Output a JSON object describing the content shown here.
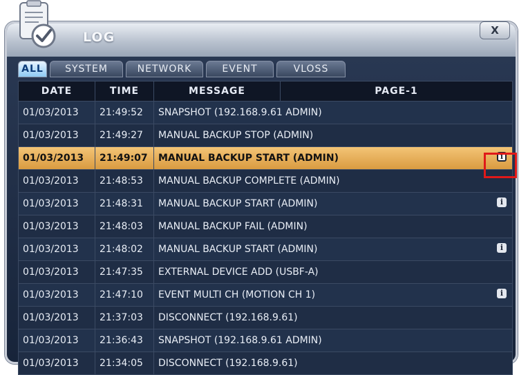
{
  "window": {
    "title": "LOG",
    "close_label": "X"
  },
  "tabs": [
    {
      "label": "ALL",
      "active": true
    },
    {
      "label": "SYSTEM",
      "active": false
    },
    {
      "label": "NETWORK",
      "active": false
    },
    {
      "label": "EVENT",
      "active": false
    },
    {
      "label": "VLOSS",
      "active": false
    }
  ],
  "table": {
    "headers": {
      "date": "DATE",
      "time": "TIME",
      "message": "MESSAGE",
      "page": "PAGE-1"
    },
    "rows": [
      {
        "date": "01/03/2013",
        "time": "21:49:52",
        "message": "SNAPSHOT (192.168.9.61 ADMIN)",
        "info": false
      },
      {
        "date": "01/03/2013",
        "time": "21:49:27",
        "message": "MANUAL BACKUP STOP (ADMIN)",
        "info": false
      },
      {
        "date": "01/03/2013",
        "time": "21:49:07",
        "message": "MANUAL BACKUP START (ADMIN)",
        "info": true,
        "selected": true
      },
      {
        "date": "01/03/2013",
        "time": "21:48:53",
        "message": "MANUAL BACKUP COMPLETE (ADMIN)",
        "info": false
      },
      {
        "date": "01/03/2013",
        "time": "21:48:31",
        "message": "MANUAL BACKUP START (ADMIN)",
        "info": true
      },
      {
        "date": "01/03/2013",
        "time": "21:48:03",
        "message": "MANUAL BACKUP FAIL (ADMIN)",
        "info": false
      },
      {
        "date": "01/03/2013",
        "time": "21:48:02",
        "message": "MANUAL BACKUP START (ADMIN)",
        "info": true
      },
      {
        "date": "01/03/2013",
        "time": "21:47:35",
        "message": "EXTERNAL DEVICE ADD (USBF-A)",
        "info": false
      },
      {
        "date": "01/03/2013",
        "time": "21:47:10",
        "message": "EVENT MULTI CH (MOTION CH 1)",
        "info": true
      },
      {
        "date": "01/03/2013",
        "time": "21:37:03",
        "message": "DISCONNECT (192.168.9.61)",
        "info": false
      },
      {
        "date": "01/03/2013",
        "time": "21:36:43",
        "message": "SNAPSHOT (192.168.9.61 ADMIN)",
        "info": false
      },
      {
        "date": "01/03/2013",
        "time": "21:34:05",
        "message": "DISCONNECT (192.168.9.61)",
        "info": false
      }
    ]
  },
  "icons": {
    "logo": "log-clipboard-check-icon",
    "info": "info-icon"
  },
  "colors": {
    "selected_row": "#e2a94e",
    "highlight_box": "#e01919",
    "active_tab": "#8fcaf3"
  }
}
